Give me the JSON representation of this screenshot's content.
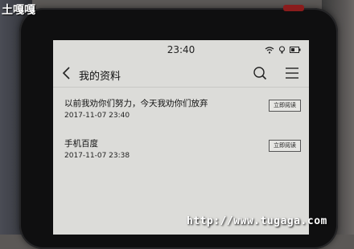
{
  "watermark": {
    "top_text": "土嘎嘎",
    "bottom_url": "http://www.tugaga.com"
  },
  "status_bar": {
    "time": "23:40"
  },
  "header": {
    "title": "我的资料"
  },
  "items": [
    {
      "title": "以前我劝你们努力，今天我劝你们放弃",
      "date": "2017-11-07 23:40",
      "button": "立即阅读"
    },
    {
      "title": "手机百度",
      "date": "2017-11-07 23:38",
      "button": "立即阅读"
    }
  ],
  "icons": [
    "back-icon",
    "search-icon",
    "menu-icon",
    "wifi-icon",
    "brightness-icon",
    "battery-icon"
  ]
}
